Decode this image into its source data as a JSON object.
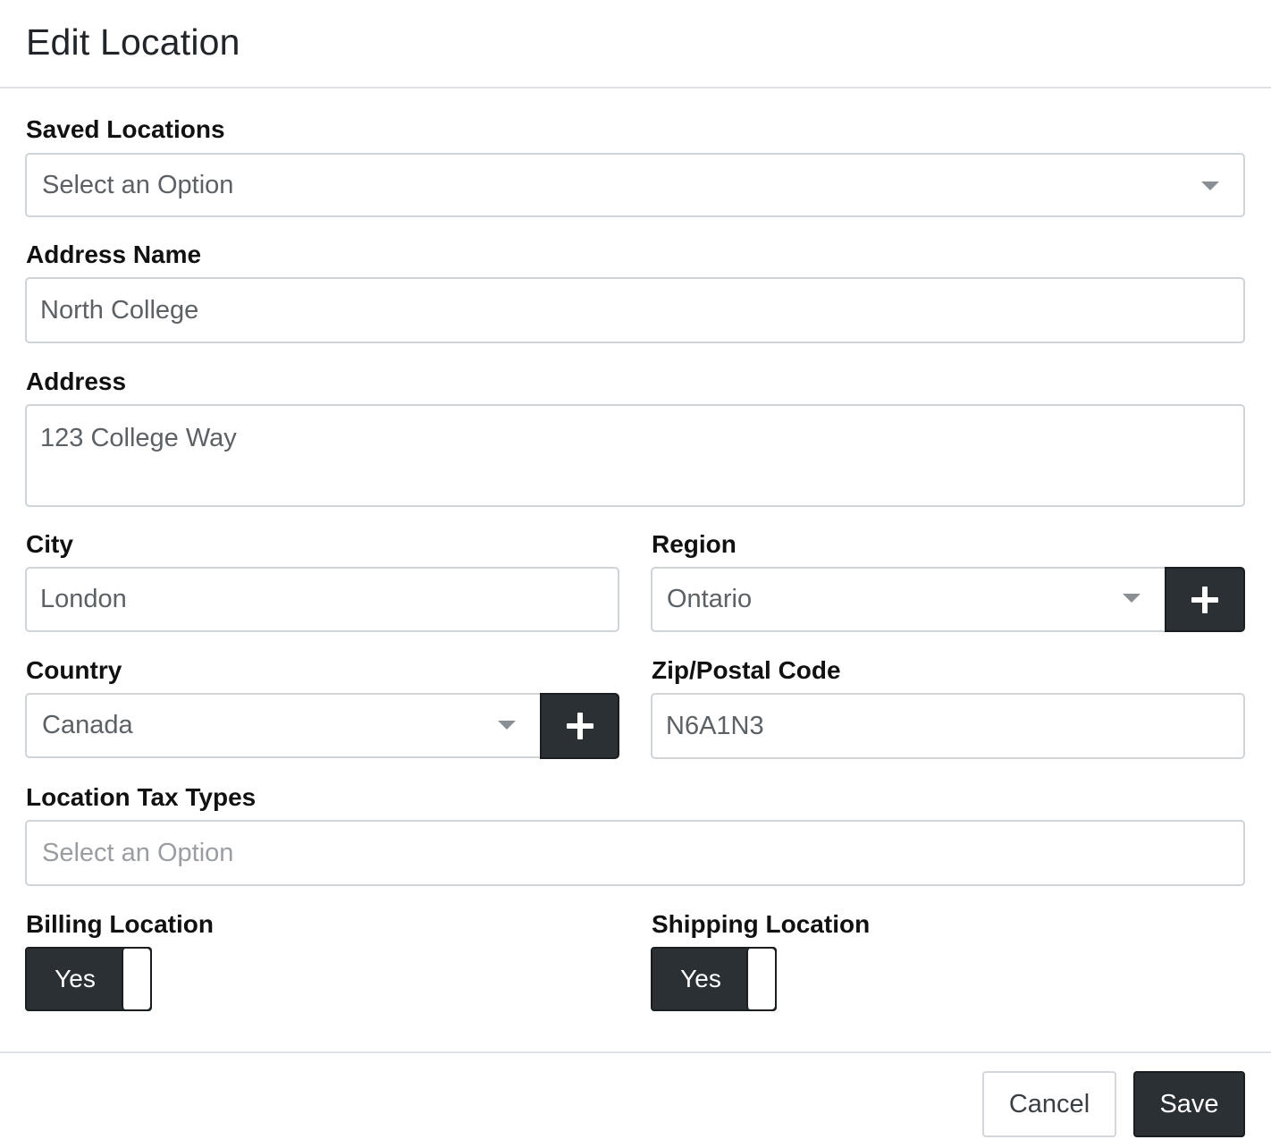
{
  "modal": {
    "title": "Edit Location"
  },
  "form": {
    "saved_locations": {
      "label": "Saved Locations",
      "value": "Select an Option"
    },
    "address_name": {
      "label": "Address Name",
      "value": "North College"
    },
    "address": {
      "label": "Address",
      "value": "123 College Way"
    },
    "city": {
      "label": "City",
      "value": "London"
    },
    "region": {
      "label": "Region",
      "value": "Ontario"
    },
    "country": {
      "label": "Country",
      "value": "Canada"
    },
    "postal_code": {
      "label": "Zip/Postal Code",
      "value": "N6A1N3"
    },
    "location_tax_types": {
      "label": "Location Tax Types",
      "placeholder": "Select an Option"
    },
    "billing_location": {
      "label": "Billing Location",
      "toggle_text": "Yes",
      "on": true
    },
    "shipping_location": {
      "label": "Shipping Location",
      "toggle_text": "Yes",
      "on": true
    }
  },
  "footer": {
    "cancel_label": "Cancel",
    "save_label": "Save"
  },
  "icons": {
    "dropdown": "chevron-down-icon",
    "add": "plus-icon"
  }
}
